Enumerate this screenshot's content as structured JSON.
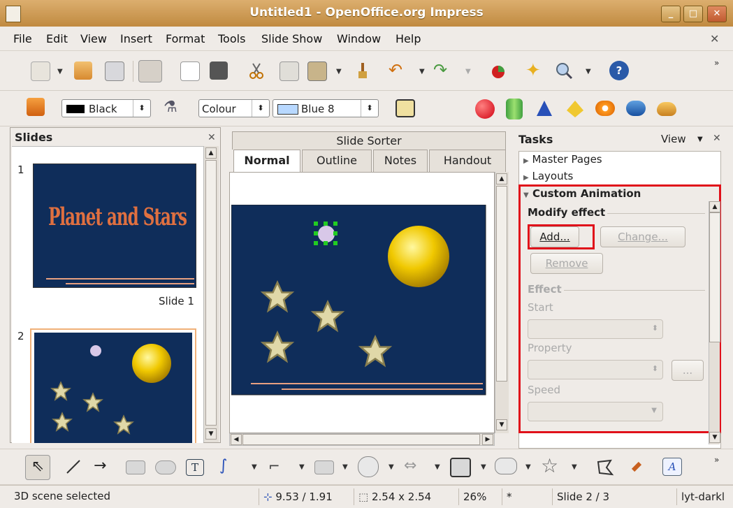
{
  "window": {
    "title": "Untitled1 - OpenOffice.org Impress"
  },
  "menu": [
    "File",
    "Edit",
    "View",
    "Insert",
    "Format",
    "Tools",
    "Slide Show",
    "Window",
    "Help"
  ],
  "line_toolbar": {
    "line_color": "Black",
    "area_style": "Colour",
    "area_color": "Blue 8"
  },
  "slides_pane": {
    "title": "Slides",
    "slides": [
      {
        "number": "1",
        "label": "Slide 1",
        "title_text": "Planet and Stars"
      },
      {
        "number": "2",
        "label": "",
        "title_text": ""
      }
    ]
  },
  "view": {
    "sorter_label": "Slide Sorter",
    "tabs": [
      "Normal",
      "Outline",
      "Notes",
      "Handout"
    ],
    "active_tab": "Normal"
  },
  "tasks": {
    "title": "Tasks",
    "view_label": "View",
    "sections": [
      "Master Pages",
      "Layouts",
      "Custom Animation"
    ],
    "modify_effect": "Modify effect",
    "add_label": "Add...",
    "change_label": "Change...",
    "remove_label": "Remove",
    "effect_label": "Effect",
    "start_label": "Start",
    "property_label": "Property",
    "speed_label": "Speed",
    "more_label": "..."
  },
  "status": {
    "message": "3D scene selected",
    "position": "9.53 / 1.91",
    "size": "2.54 x 2.54",
    "zoom": "26%",
    "modified": "*",
    "slide": "Slide 2 / 3",
    "layout": "lyt-darkl"
  },
  "colors": {
    "title_bar": "#c8964c",
    "slide_bg": "#0f2d5a",
    "highlight": "#e0101a",
    "selection": "#22cc22"
  }
}
